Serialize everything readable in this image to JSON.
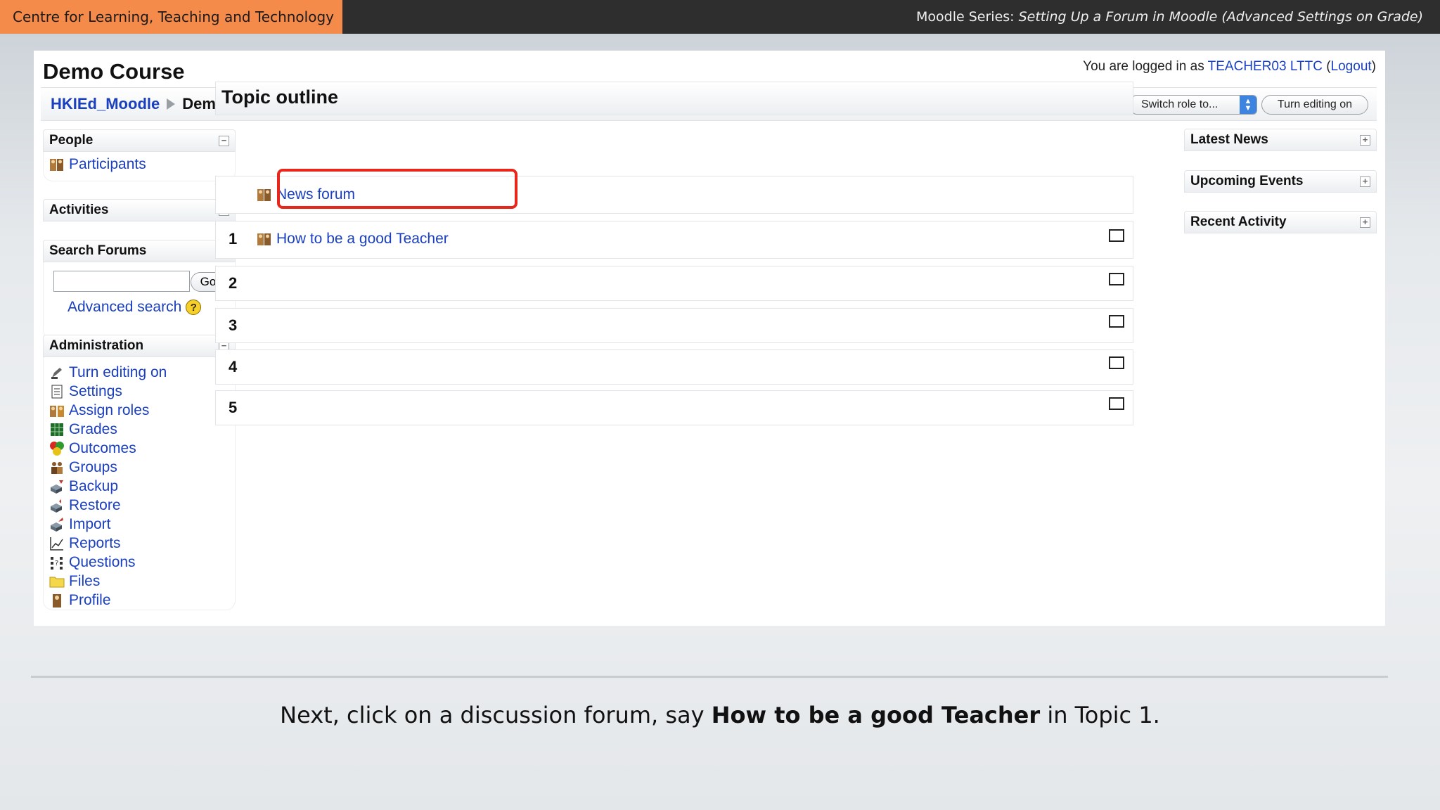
{
  "banner": {
    "left": "Centre for Learning, Teaching and Technology",
    "series": "Moodle Series:",
    "title": "Setting Up a Forum in Moodle (Advanced Settings on Grade)"
  },
  "course": {
    "title": "Demo Course",
    "login_prefix": "You are logged in as",
    "user": "TEACHER03 LTTC",
    "logout": "Logout"
  },
  "breadcrumb": {
    "home": "HKIEd_Moodle",
    "current": "Demo Course"
  },
  "toolbar": {
    "help": "?",
    "switch_role": "Switch role to...",
    "turn_editing": "Turn editing on"
  },
  "left_blocks": {
    "people": {
      "title": "People",
      "toggle": "−",
      "items": [
        "Participants"
      ]
    },
    "activities": {
      "title": "Activities",
      "toggle": "+"
    },
    "search": {
      "title": "Search Forums",
      "toggle": "−",
      "go": "Go",
      "advanced": "Advanced search",
      "value": ""
    },
    "admin": {
      "title": "Administration",
      "toggle": "−",
      "items": [
        "Turn editing on",
        "Settings",
        "Assign roles",
        "Grades",
        "Outcomes",
        "Groups",
        "Backup",
        "Restore",
        "Import",
        "Reports",
        "Questions",
        "Files",
        "Profile"
      ]
    }
  },
  "topic": {
    "title": "Topic outline",
    "news": "News forum",
    "sections": [
      {
        "num": "1",
        "item": "How to be a good Teacher"
      },
      {
        "num": "2"
      },
      {
        "num": "3"
      },
      {
        "num": "4"
      },
      {
        "num": "5"
      }
    ]
  },
  "right_blocks": {
    "latest_news": {
      "title": "Latest News",
      "toggle": "+"
    },
    "upcoming": {
      "title": "Upcoming Events",
      "toggle": "+"
    },
    "recent": {
      "title": "Recent Activity",
      "toggle": "+"
    }
  },
  "caption": {
    "before": "Next, click on a discussion forum, say",
    "bold": "How to be a good Teacher",
    "after": "in Topic 1."
  },
  "colors": {
    "accent": "#f58b4b",
    "link": "#1a3fbf",
    "highlight": "#e8261a",
    "banner": "#2e2e2e"
  }
}
